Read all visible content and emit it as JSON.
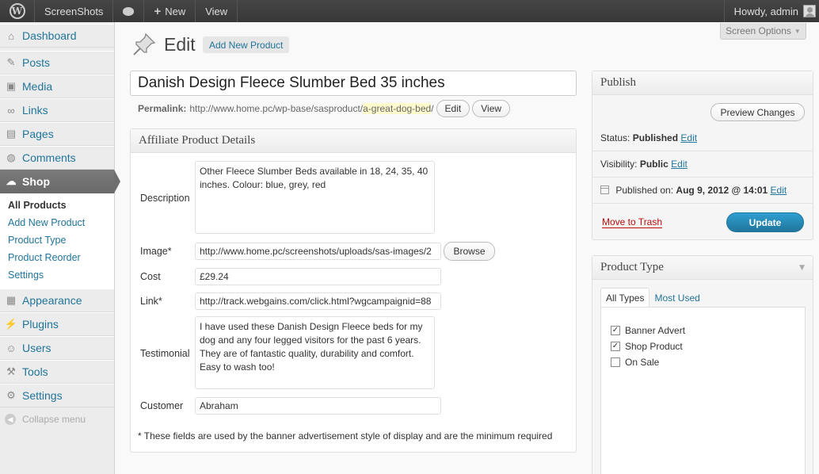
{
  "adminbar": {
    "site_name": "ScreenShots",
    "new_label": "New",
    "view_label": "View",
    "greeting": "Howdy, admin"
  },
  "sidebar": {
    "items": [
      {
        "label": "Dashboard",
        "icon": "dashboard-icon"
      },
      {
        "label": "Posts",
        "icon": "pushpin-icon"
      },
      {
        "label": "Media",
        "icon": "media-icon"
      },
      {
        "label": "Links",
        "icon": "link-icon"
      },
      {
        "label": "Pages",
        "icon": "pages-icon"
      },
      {
        "label": "Comments",
        "icon": "comment-icon"
      },
      {
        "label": "Shop",
        "icon": "shop-icon"
      }
    ],
    "shop_submenu": [
      "All Products",
      "Add New Product",
      "Product Type",
      "Product Reorder",
      "Settings"
    ],
    "items_after": [
      {
        "label": "Appearance",
        "icon": "appearance-icon"
      },
      {
        "label": "Plugins",
        "icon": "plugin-icon"
      },
      {
        "label": "Users",
        "icon": "users-icon"
      },
      {
        "label": "Tools",
        "icon": "tools-icon"
      },
      {
        "label": "Settings",
        "icon": "settings-icon"
      }
    ],
    "collapse_label": "Collapse menu"
  },
  "header": {
    "screen_options": "Screen Options",
    "title": "Edit",
    "add_new": "Add New Product"
  },
  "post": {
    "title": "Danish Design Fleece Slumber Bed 35 inches",
    "permalink_label": "Permalink:",
    "permalink_base": "http://www.home.pc/wp-base/sasproduct/",
    "permalink_slug": "a-great-dog-bed",
    "permalink_end": "/",
    "edit_btn": "Edit",
    "view_btn": "View"
  },
  "affiliate": {
    "title": "Affiliate Product Details",
    "description_label": "Description",
    "description": "Other Fleece Slumber Beds available in 18, 24, 35, 40 inches. Colour: blue, grey, red",
    "image_label": "Image*",
    "image": "http://www.home.pc/screenshots/uploads/sas-images/2",
    "browse": "Browse",
    "cost_label": "Cost",
    "cost": "£29.24",
    "link_label": "Link*",
    "link": "http://track.webgains.com/click.html?wgcampaignid=88",
    "testimonial_label": "Testimonial",
    "testimonial": "I have used these Danish Design Fleece beds for my dog and any four legged visitors for the past 6 years. They are of fantastic quality, durability and comfort. Easy to wash too!",
    "customer_label": "Customer",
    "customer": "Abraham",
    "note": "* These fields are used by the banner advertisement style of display and are the minimum required"
  },
  "publish": {
    "title": "Publish",
    "preview": "Preview Changes",
    "status_label": "Status:",
    "status": "Published",
    "visibility_label": "Visibility:",
    "visibility": "Public",
    "published_label": "Published on:",
    "published_on": "Aug 9, 2012 @ 14:01",
    "edit": "Edit",
    "trash": "Move to Trash",
    "update": "Update"
  },
  "product_type": {
    "title": "Product Type",
    "tabs": [
      "All Types",
      "Most Used"
    ],
    "options": [
      {
        "label": "Banner Advert",
        "checked": true
      },
      {
        "label": "Shop Product",
        "checked": true
      },
      {
        "label": "On Sale",
        "checked": false
      }
    ]
  }
}
